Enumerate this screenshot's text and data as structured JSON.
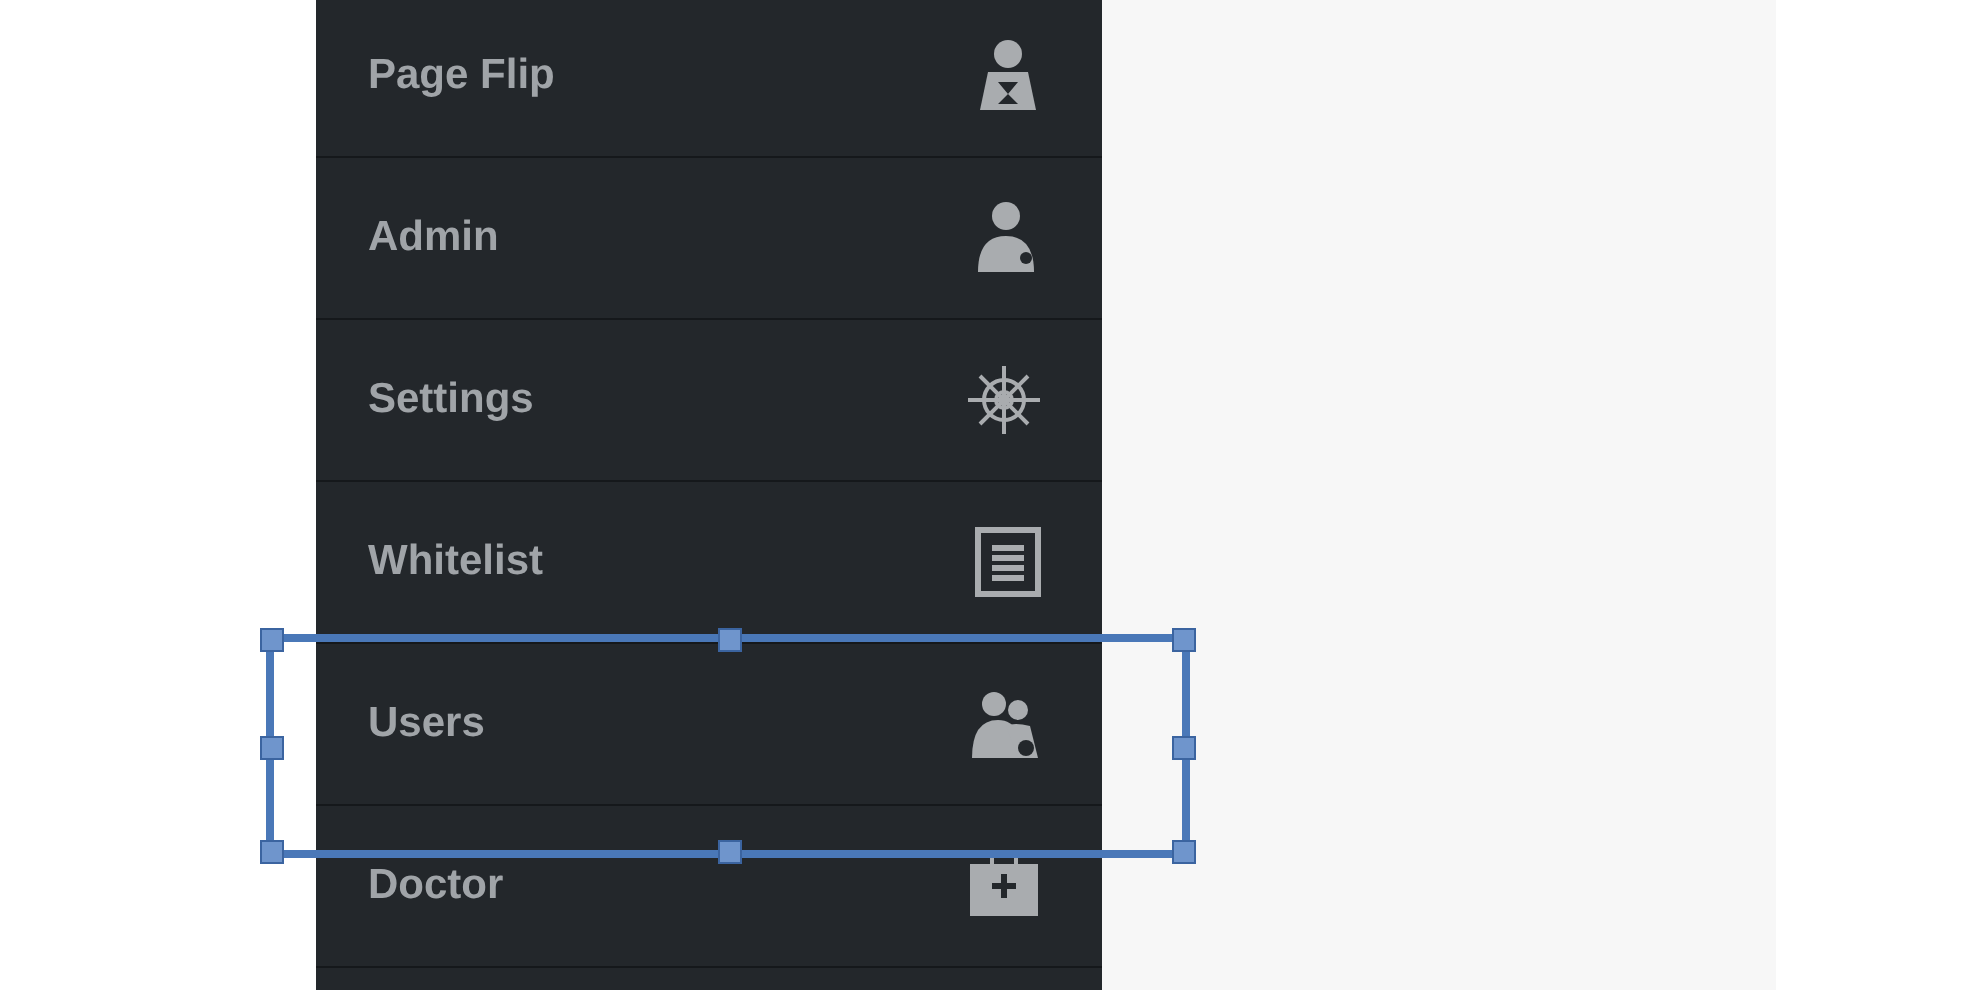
{
  "sidebar": {
    "items": [
      {
        "label": "Page Flip",
        "selected": false
      },
      {
        "label": "Admin",
        "selected": false
      },
      {
        "label": "Settings",
        "selected": false
      },
      {
        "label": "Whitelist",
        "selected": false
      },
      {
        "label": "Users",
        "selected": true
      },
      {
        "label": "Doctor",
        "selected": false
      }
    ]
  }
}
